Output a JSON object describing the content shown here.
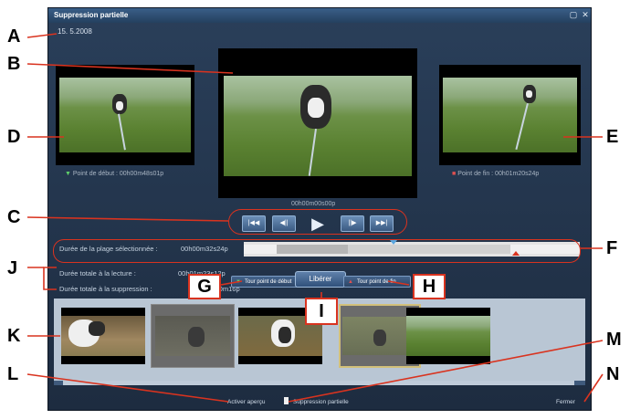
{
  "window": {
    "title": "Suppression partielle",
    "date": "15. 5.2008",
    "title_icons": [
      "restore-icon",
      "close-icon"
    ],
    "close_glyph": "✕",
    "restore_glyph": "▢"
  },
  "preview": {
    "start_point_label": "Point de début : 00h00m48s01p",
    "end_point_label": "Point de fin : 00h01m20s24p",
    "current_timecode": "00h00m00s00p"
  },
  "controls": {
    "first_glyph": "|◀◀",
    "step_back_glyph": "◀||",
    "play_glyph": "▶",
    "step_fwd_glyph": "||▶",
    "last_glyph": "▶▶|"
  },
  "range": {
    "duration_label": "Durée de la plage sélectionnée :",
    "duration_value": "00h00m32s24p",
    "playback_total_label": "Durée totale à la lecture :",
    "playback_total_value": "00h01m23s12p",
    "deletion_total_label": "Durée totale à la suppression :",
    "deletion_total_value": "00h00m16p"
  },
  "buttons": {
    "set_start": "Tour point de début",
    "set_end": "Tour point de fin",
    "release": "Libérer",
    "preview": "Activer aperçu",
    "partial_delete": "Suppression partielle",
    "close": "Fermer"
  },
  "thumbnails": [
    {
      "kind": "dog-closeup"
    },
    {
      "kind": "dim-dog"
    },
    {
      "kind": "dog-grass"
    },
    {
      "kind": "dim-dog-selected"
    },
    {
      "kind": "grass"
    }
  ],
  "callouts": [
    "A",
    "B",
    "C",
    "D",
    "E",
    "F",
    "G",
    "H",
    "I",
    "J",
    "K",
    "L",
    "M",
    "N"
  ],
  "colors": {
    "callout": "#d9331f",
    "window_bg": "#1d2c40",
    "titlebar": "#2e4e72",
    "slider_red": "#d9331f"
  }
}
